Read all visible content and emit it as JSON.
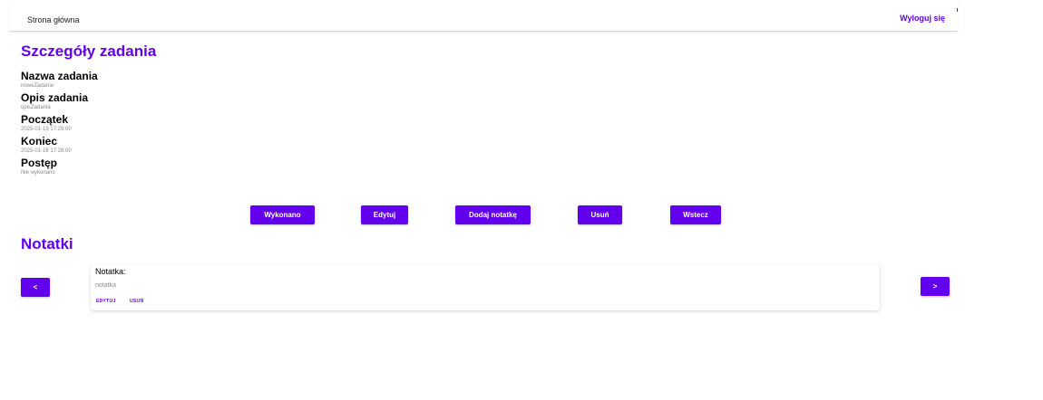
{
  "nav": {
    "home_label": "Strona główna",
    "logout_label": "Wyloguj się"
  },
  "details": {
    "heading": "Szczegóły zadania",
    "fields": [
      {
        "label": "Nazwa zadania",
        "value": "noweZadanie"
      },
      {
        "label": "Opis zadania",
        "value": "opisZadania"
      },
      {
        "label": "Początek",
        "value": "2025-01-15 17:29:00"
      },
      {
        "label": "Koniec",
        "value": "2025-01-16 17:28:00"
      },
      {
        "label": "Postęp",
        "value": "Nie wykonano"
      }
    ]
  },
  "actions": {
    "done_label": "Wykonano",
    "edit_label": "Edytuj",
    "add_note_label": "Dodaj notatkę",
    "delete_label": "Usuń",
    "back_label": "Wstecz"
  },
  "notes": {
    "heading": "Notatki",
    "prev_label": "<",
    "next_label": ">",
    "items": [
      {
        "title": "Notatka:",
        "body": "notatka",
        "edit_label": "EDYTUJ",
        "delete_label": "USUŃ"
      }
    ]
  },
  "colors": {
    "accent": "#6200ee",
    "muted_text": "#8a8a8a"
  }
}
